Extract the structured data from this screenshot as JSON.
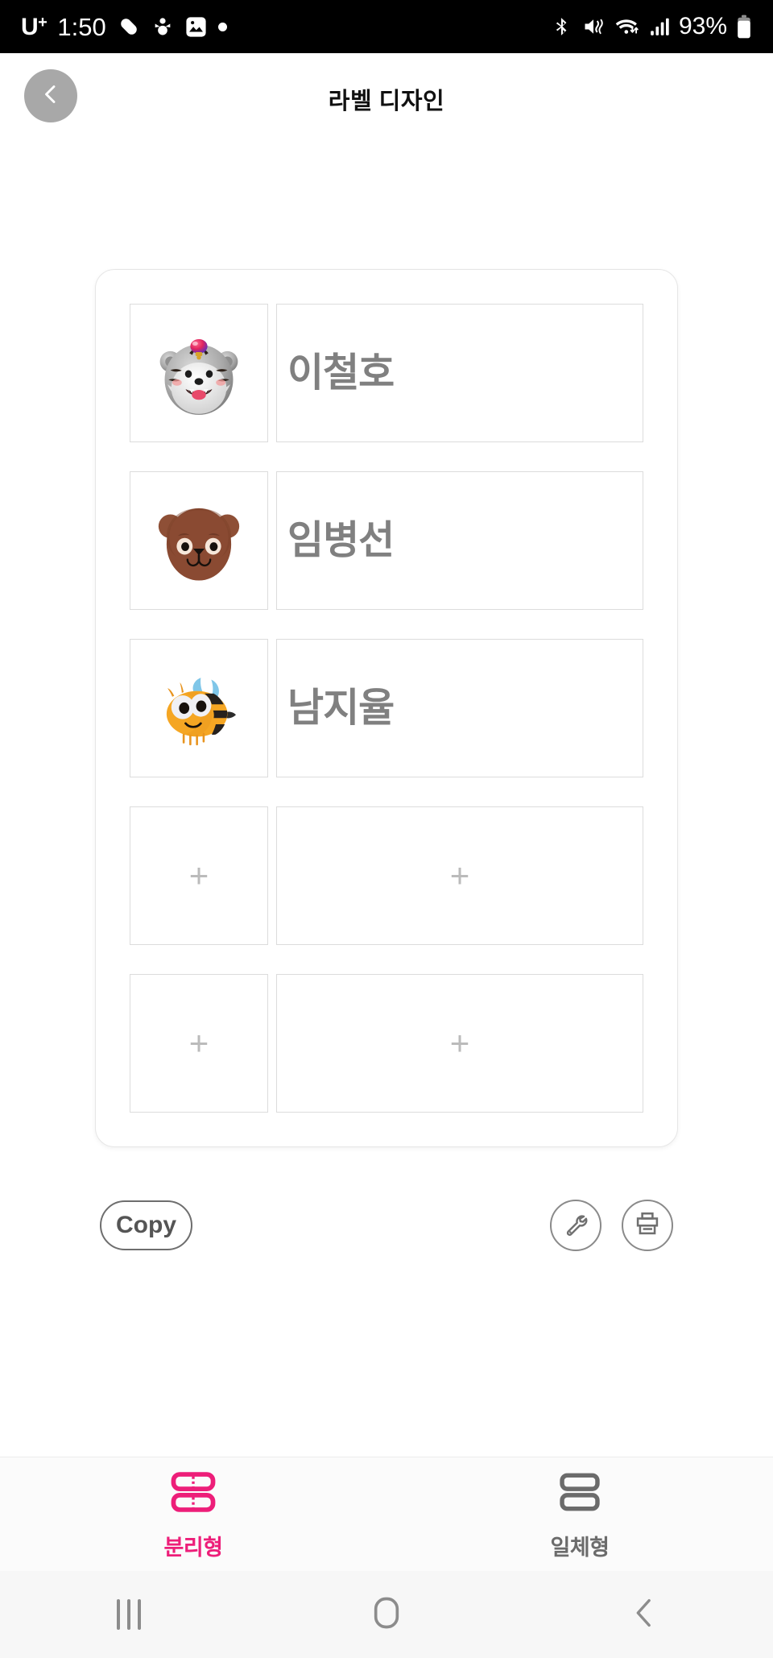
{
  "statusbar": {
    "carrier": "U",
    "carrier_sup": "+",
    "time": "1:50",
    "battery_text": "93%",
    "left_icons": [
      "pill-icon",
      "snowman-icon",
      "gallery-image-icon",
      "dot-icon"
    ],
    "right_icons": [
      "bluetooth-icon",
      "mute-vibrate-icon",
      "wifi-transfer-icon",
      "signal-bars-icon",
      "battery-icon"
    ]
  },
  "header": {
    "title": "라벨 디자인",
    "back_icon": "chevron-left-icon"
  },
  "label_rows": [
    {
      "name": "이철호",
      "avatar": "tiger-cub-avatar",
      "empty": false
    },
    {
      "name": "임병선",
      "avatar": "bear-face-avatar",
      "empty": false
    },
    {
      "name": "남지율",
      "avatar": "honeybee-avatar",
      "empty": false
    },
    {
      "name": "+",
      "avatar": "+",
      "empty": true
    },
    {
      "name": "+",
      "avatar": "+",
      "empty": true
    }
  ],
  "actions": {
    "copy_label": "Copy",
    "settings_icon": "wrench-icon",
    "print_icon": "printer-icon"
  },
  "tabs": [
    {
      "label": "분리형",
      "icon": "split-label-icon",
      "active": true
    },
    {
      "label": "일체형",
      "icon": "single-label-icon",
      "active": false
    }
  ],
  "navbar": {
    "recents_icon": "recents-icon",
    "home_icon": "home-icon",
    "back_icon": "back-chevron-icon"
  },
  "colors": {
    "accent": "#ED1E79",
    "text_gray": "#808080",
    "border_gray": "#dcdcdc",
    "status_bg": "#000000"
  }
}
